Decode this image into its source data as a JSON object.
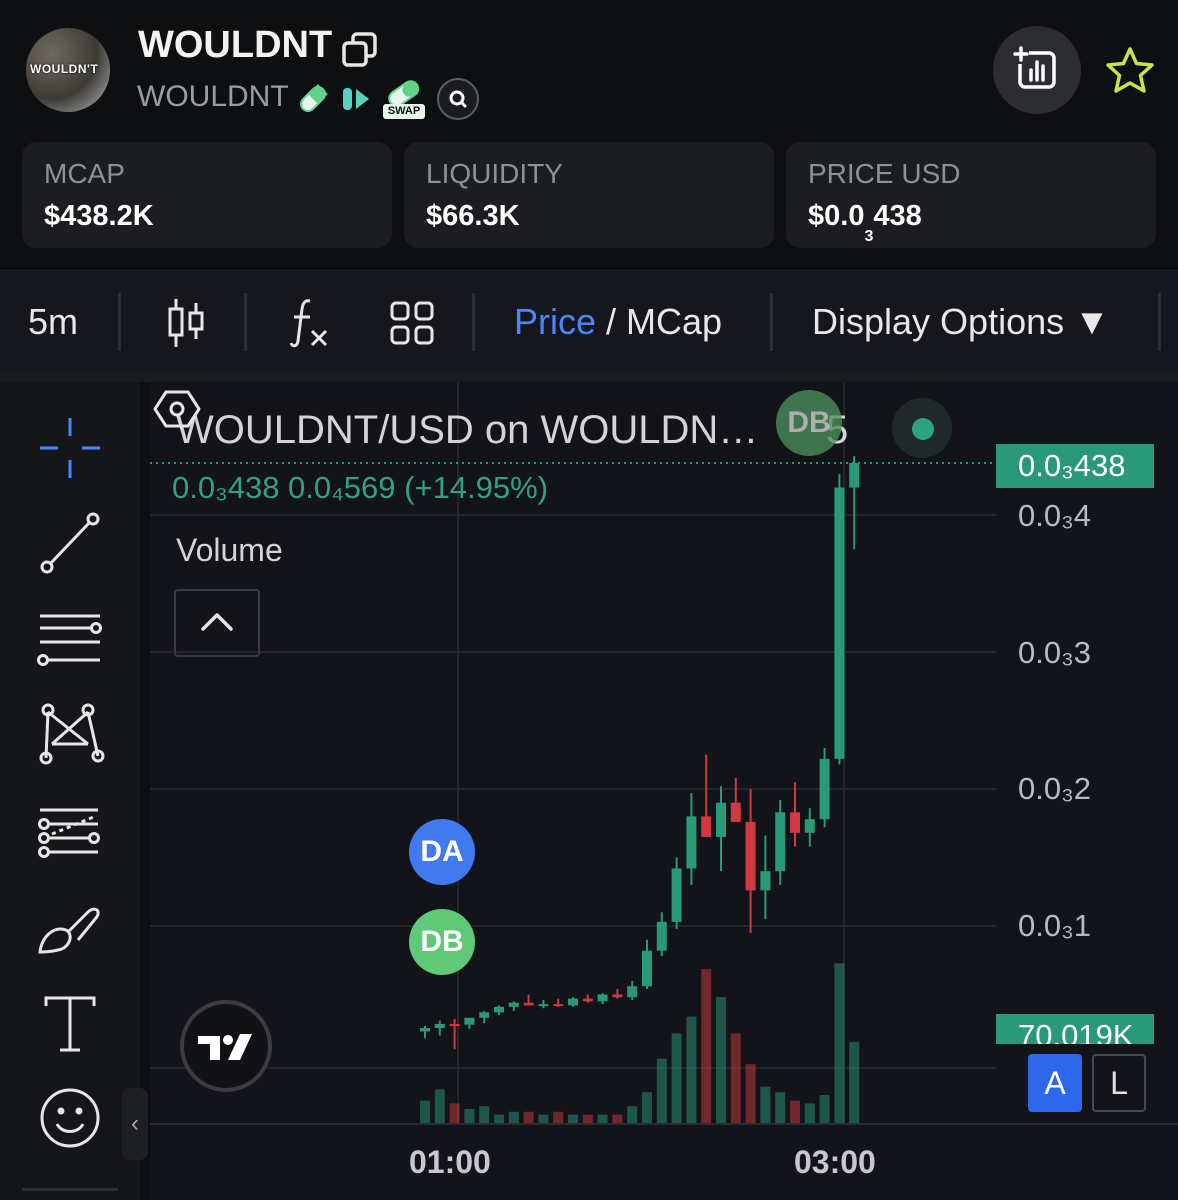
{
  "header": {
    "avatar_text": "WOULDN'T",
    "token_name": "WOULDNT",
    "token_symbol": "WOULDNT",
    "swap_badge": "SWAP"
  },
  "stats": [
    {
      "label": "MCAP",
      "value": "$438.2K"
    },
    {
      "label": "LIQUIDITY",
      "value": "$66.3K"
    },
    {
      "label": "PRICE USD",
      "value_main": "$0.0",
      "value_sub": "3",
      "value_rest": "438"
    }
  ],
  "toolbar": {
    "interval": "5m",
    "mode_price": "Price",
    "mode_sep": " / ",
    "mode_mcap": "MCap",
    "display_options": "Display Options ▼"
  },
  "colors": {
    "up": "#2a9977",
    "down": "#d0393f",
    "accent": "#4b86ff",
    "star": "#c4e64a"
  },
  "chart": {
    "legend_title": "WOULDNT/USD on WOULDN…",
    "legend_suffix": "5",
    "legend_values": "0.0₃438  0.0₄569 (+14.95%)",
    "volume_label": "Volume",
    "price_tag": "0.0₃438",
    "volume_tag": "70.019K",
    "scale_a": "A",
    "scale_l": "L",
    "markers": {
      "da": "DA",
      "db": "DB",
      "db_top": "DB"
    },
    "ytick_labels": [
      "0.0₃4",
      "0.0₃3",
      "0.0₃2",
      "0.0₃1"
    ],
    "xtick_labels": [
      "01:00",
      "03:00"
    ]
  },
  "chart_data": {
    "type": "candlestick",
    "title": "WOULDNT/USD on WOULDN…",
    "series_name": "WOULDNT/USD",
    "interval": "5m",
    "price_unit": "USD",
    "price_scale_note": "0.0₃1 = 0.0001",
    "ylim": [
      3e-06,
      0.00047
    ],
    "x_ticks": [
      "01:00",
      "03:00"
    ],
    "y_ticks": [
      0.0001,
      0.0002,
      0.0003,
      0.0004
    ],
    "last_price": 0.000438,
    "last_change": 5.69e-05,
    "last_change_pct": 14.95,
    "last_volume_label": "70.019K",
    "candles": [
      {
        "o": 2.3e-05,
        "h": 2.7e-05,
        "l": 1.8e-05,
        "c": 2.55e-05,
        "v": 8
      },
      {
        "o": 2.55e-05,
        "h": 3.1e-05,
        "l": 2e-05,
        "c": 2.85e-05,
        "v": 12
      },
      {
        "o": 2.85e-05,
        "h": 3.2e-05,
        "l": 1e-05,
        "c": 2.8e-05,
        "v": 7
      },
      {
        "o": 2.8e-05,
        "h": 3.3e-05,
        "l": 2.5e-05,
        "c": 3.3e-05,
        "v": 5
      },
      {
        "o": 3.3e-05,
        "h": 3.8e-05,
        "l": 2.9e-05,
        "c": 3.7e-05,
        "v": 6
      },
      {
        "o": 3.7e-05,
        "h": 4.2e-05,
        "l": 3.5e-05,
        "c": 4.1e-05,
        "v": 3
      },
      {
        "o": 4.1e-05,
        "h": 4.5e-05,
        "l": 3.8e-05,
        "c": 4.4e-05,
        "v": 4
      },
      {
        "o": 4.4e-05,
        "h": 5e-05,
        "l": 4.2e-05,
        "c": 4.2e-05,
        "v": 4
      },
      {
        "o": 4.2e-05,
        "h": 4.6e-05,
        "l": 4e-05,
        "c": 4.3e-05,
        "v": 3
      },
      {
        "o": 4.3e-05,
        "h": 4.7e-05,
        "l": 4.1e-05,
        "c": 4.2e-05,
        "v": 4
      },
      {
        "o": 4.2e-05,
        "h": 4.8e-05,
        "l": 4.1e-05,
        "c": 4.7e-05,
        "v": 3
      },
      {
        "o": 4.7e-05,
        "h": 5e-05,
        "l": 4.4e-05,
        "c": 4.5e-05,
        "v": 3
      },
      {
        "o": 4.5e-05,
        "h": 5.1e-05,
        "l": 4.3e-05,
        "c": 5e-05,
        "v": 3
      },
      {
        "o": 5e-05,
        "h": 5.4e-05,
        "l": 4.7e-05,
        "c": 4.8e-05,
        "v": 3
      },
      {
        "o": 4.8e-05,
        "h": 6e-05,
        "l": 4.6e-05,
        "c": 5.6e-05,
        "v": 6
      },
      {
        "o": 5.6e-05,
        "h": 9e-05,
        "l": 5.4e-05,
        "c": 8.2e-05,
        "v": 11
      },
      {
        "o": 8.2e-05,
        "h": 0.00011,
        "l": 7.8e-05,
        "c": 0.000103,
        "v": 23
      },
      {
        "o": 0.000103,
        "h": 0.00015,
        "l": 9.8e-05,
        "c": 0.000142,
        "v": 32
      },
      {
        "o": 0.000142,
        "h": 0.000197,
        "l": 0.00013,
        "c": 0.00018,
        "v": 38
      },
      {
        "o": 0.00018,
        "h": 0.000225,
        "l": 0.00017,
        "c": 0.000165,
        "v": 55
      },
      {
        "o": 0.000165,
        "h": 0.000202,
        "l": 0.00014,
        "c": 0.00019,
        "v": 45
      },
      {
        "o": 0.00019,
        "h": 0.000208,
        "l": 0.000176,
        "c": 0.000176,
        "v": 32
      },
      {
        "o": 0.000176,
        "h": 0.0002,
        "l": 9.5e-05,
        "c": 0.000126,
        "v": 21
      },
      {
        "o": 0.000126,
        "h": 0.000166,
        "l": 0.000105,
        "c": 0.00014,
        "v": 13
      },
      {
        "o": 0.00014,
        "h": 0.000192,
        "l": 0.00013,
        "c": 0.000183,
        "v": 11
      },
      {
        "o": 0.000183,
        "h": 0.000205,
        "l": 0.000158,
        "c": 0.000168,
        "v": 8
      },
      {
        "o": 0.000168,
        "h": 0.000186,
        "l": 0.000158,
        "c": 0.000178,
        "v": 7
      },
      {
        "o": 0.000178,
        "h": 0.00023,
        "l": 0.000172,
        "c": 0.000222,
        "v": 10
      },
      {
        "o": 0.000222,
        "h": 0.00043,
        "l": 0.000218,
        "c": 0.00042,
        "v": 57
      },
      {
        "o": 0.00042,
        "h": 0.000443,
        "l": 0.000375,
        "c": 0.000438,
        "v": 29
      }
    ]
  }
}
